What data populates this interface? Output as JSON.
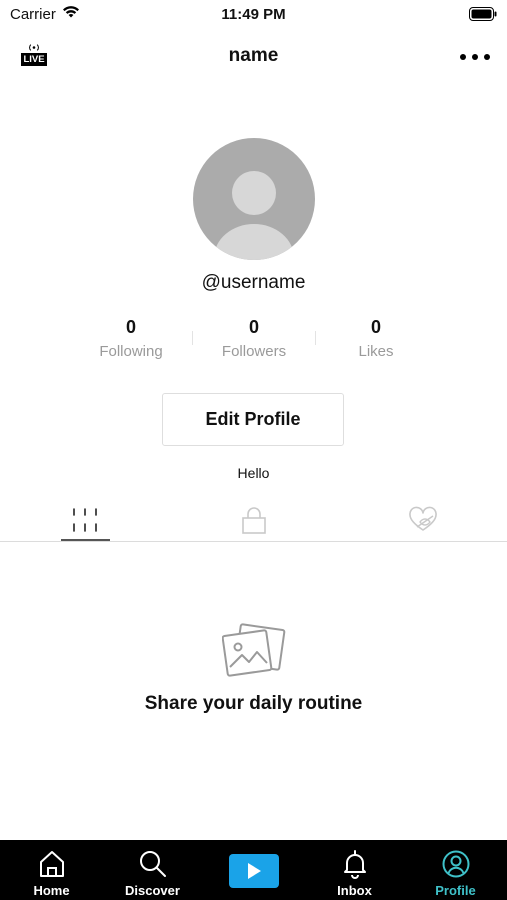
{
  "status_bar": {
    "carrier": "Carrier",
    "time": "11:49 PM"
  },
  "nav": {
    "live_badge": "LIVE",
    "title": "name"
  },
  "profile": {
    "username": "@username",
    "stats": [
      {
        "value": "0",
        "label": "Following"
      },
      {
        "value": "0",
        "label": "Followers"
      },
      {
        "value": "0",
        "label": "Likes"
      }
    ],
    "edit_button": "Edit Profile",
    "bio": "Hello"
  },
  "content_tabs": [
    {
      "icon": "grid-icon",
      "active": true
    },
    {
      "icon": "lock-icon",
      "active": false
    },
    {
      "icon": "heart-hidden-icon",
      "active": false
    }
  ],
  "empty_state": {
    "icon": "photos-icon",
    "message": "Share your daily routine"
  },
  "tab_bar": {
    "items": [
      {
        "label": "Home",
        "icon": "home-icon"
      },
      {
        "label": "Discover",
        "icon": "search-icon"
      },
      {
        "label": "",
        "icon": "play-icon"
      },
      {
        "label": "Inbox",
        "icon": "bell-icon"
      },
      {
        "label": "Profile",
        "icon": "person-icon",
        "active": true
      }
    ]
  },
  "colors": {
    "accent": "#3fc1c9",
    "create_button": "#1aa3e8",
    "tab_bar_bg": "#000000"
  }
}
